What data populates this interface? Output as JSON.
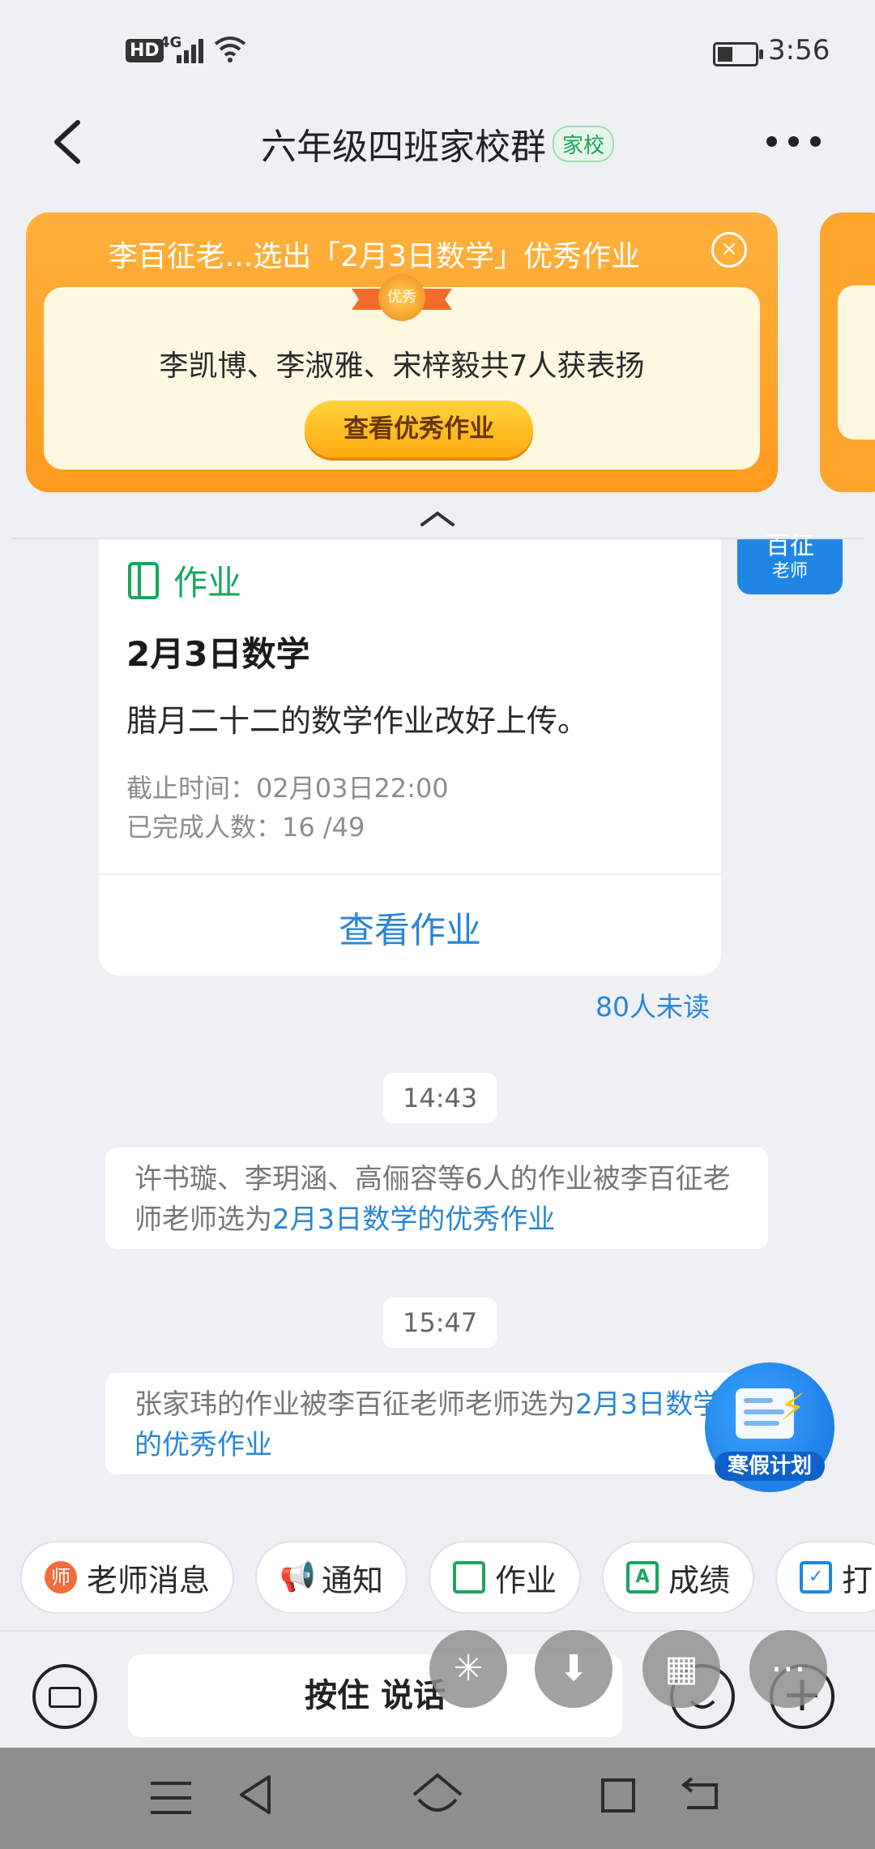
{
  "status_bar": {
    "hd": "HD",
    "network": "4G",
    "time": "3:56"
  },
  "header": {
    "title": "六年级四班家校群",
    "tag": "家校"
  },
  "banner": {
    "title": "李百征老...选出「2月3日数学」优秀作业",
    "medal": "优秀",
    "names": "李凯博、李淑雅、宋梓毅共7人获表扬",
    "button": "查看优秀作业"
  },
  "teacher_badge": {
    "name": "百征",
    "role": "老师"
  },
  "homework": {
    "type": "作业",
    "title": "2月3日数学",
    "description": "腊月二十二的数学作业改好上传。",
    "deadline": "截止时间：02月03日22:00",
    "completed": "已完成人数：16 /49",
    "view_button": "查看作业",
    "unread": "80人未读"
  },
  "messages": [
    {
      "time": "14:43",
      "text": "许书璇、李玥涵、高俪容等6人的作业被李百征老师老师选为",
      "link": "2月3日数学的优秀作业"
    },
    {
      "time": "15:47",
      "text": "张家玮的作业被李百征老师老师选为",
      "link": "2月3日数学的优秀作业"
    }
  ],
  "winter_plan": {
    "label": "寒假计划"
  },
  "quick_tabs": [
    {
      "label": "老师消息",
      "icon": "teacher-icon",
      "glyph": "师"
    },
    {
      "label": "通知",
      "icon": "megaphone-icon"
    },
    {
      "label": "作业",
      "icon": "homework-icon"
    },
    {
      "label": "成绩",
      "icon": "score-icon",
      "glyph": "A"
    },
    {
      "label": "打",
      "icon": "calendar-check-icon"
    }
  ],
  "input_bar": {
    "hold_to_talk": "按住 说话"
  },
  "colors": {
    "accent_green": "#1ba55e",
    "link_blue": "#2a86d6",
    "banner_orange": "#ffa52b"
  }
}
